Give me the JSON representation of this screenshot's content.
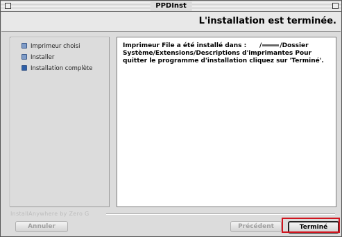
{
  "window": {
    "title": "PPDInst"
  },
  "header": {
    "title": "L'installation est terminée."
  },
  "steps": [
    {
      "label": "Imprimeur choisi",
      "state": "done"
    },
    {
      "label": "Installer",
      "state": "done"
    },
    {
      "label": "Installation complète",
      "state": "current"
    }
  ],
  "message": {
    "line1_prefix": "Imprimeur File a été installé dans :",
    "line1_path_start": "/",
    "line1_path_end": "/Dossier",
    "line2": "Système/Extensions/Descriptions d'imprimantes  Pour",
    "line3": "quitter le programme d'installation cliquez sur 'Terminé'."
  },
  "footer": {
    "brand": "InstallAnywhere by Zero G",
    "cancel_label": "Annuler",
    "previous_label": "Précédent",
    "done_label": "Terminé"
  },
  "colors": {
    "window_background": "#dcdcdc",
    "step_bullet": "#7f9cc8",
    "highlight": "#d0141e"
  }
}
